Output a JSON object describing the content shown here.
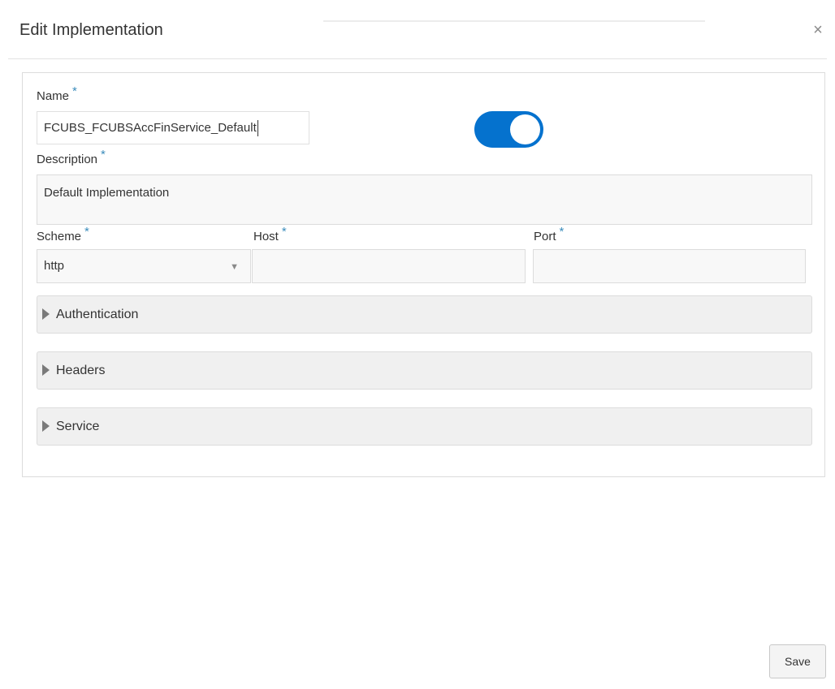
{
  "dialog": {
    "title": "Edit Implementation",
    "close_glyph": "×"
  },
  "form": {
    "name": {
      "label": "Name",
      "required": "*",
      "value": "FCUBS_FCUBSAccFinService_Default"
    },
    "enabled_toggle": {
      "state": "on",
      "color": "#0572ce"
    },
    "description": {
      "label": "Description",
      "required": "*",
      "value": "Default Implementation"
    },
    "scheme": {
      "label": "Scheme",
      "required": "*",
      "value": "http",
      "arrow_glyph": "▼"
    },
    "host": {
      "label": "Host",
      "required": "*",
      "value": ""
    },
    "port": {
      "label": "Port",
      "required": "*",
      "value": ""
    }
  },
  "sections": [
    {
      "label": "Authentication",
      "icon": "caret-right-icon"
    },
    {
      "label": "Headers",
      "icon": "caret-right-icon"
    },
    {
      "label": "Service",
      "icon": "caret-right-icon"
    }
  ],
  "footer": {
    "save_label": "Save"
  }
}
